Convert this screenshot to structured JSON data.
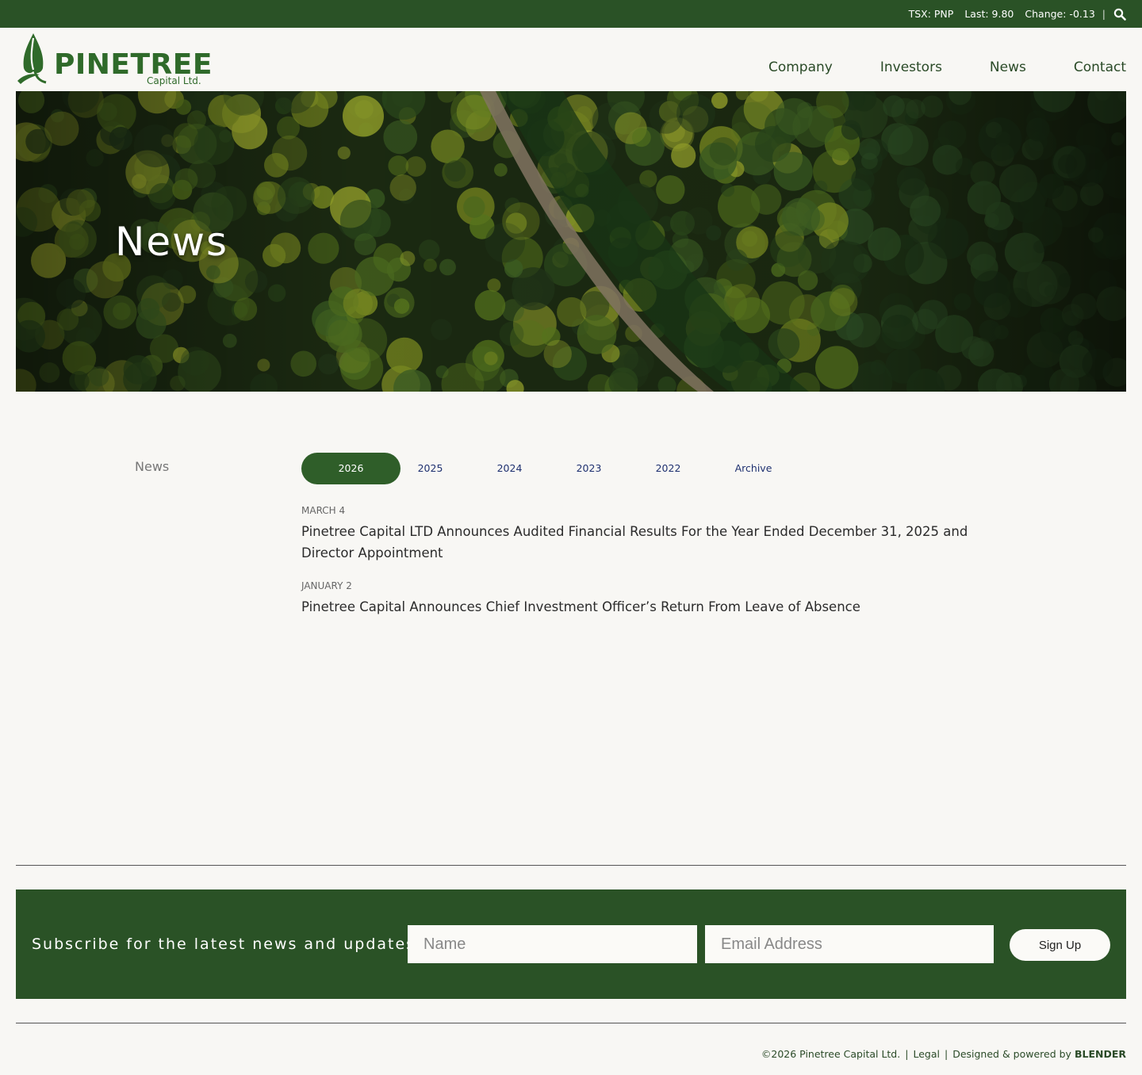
{
  "ticker": {
    "symbol": "TSX: PNP",
    "last": "Last: 9.80",
    "change": "Change: -0.13",
    "separator": "|",
    "search_icon": "search-icon"
  },
  "logo": {
    "word": "PINETREE",
    "sub": "Capital Ltd.",
    "icon": "pine-tree-logo-icon",
    "color": "#2f6a2a"
  },
  "nav": [
    {
      "label": "Company"
    },
    {
      "label": "Investors"
    },
    {
      "label": "News"
    },
    {
      "label": "Contact"
    }
  ],
  "hero": {
    "title": "News"
  },
  "sidebar": {
    "label": "News"
  },
  "year_tabs": [
    {
      "label": "2026",
      "active": true
    },
    {
      "label": "2025",
      "active": false
    },
    {
      "label": "2024",
      "active": false
    },
    {
      "label": "2023",
      "active": false
    },
    {
      "label": "2022",
      "active": false
    },
    {
      "label": "Archive",
      "active": false
    }
  ],
  "news": [
    {
      "date": "MARCH 4",
      "title": "Pinetree Capital LTD Announces Audited Financial Results For the Year Ended December 31, 2025 and Director Appointment"
    },
    {
      "date": "JANUARY 2",
      "title": "Pinetree Capital Announces Chief Investment Officer’s Return From Leave of Absence"
    }
  ],
  "subscribe": {
    "label": "Subscribe for the latest news and updates",
    "name_placeholder": "Name",
    "email_placeholder": "Email Address",
    "button": "Sign Up"
  },
  "footer": {
    "copyright": "©2026 Pinetree Capital Ltd.",
    "legal": "Legal",
    "designed": "Designed & powered by",
    "brand": "BLENDER",
    "pipe": "|"
  },
  "colors": {
    "brand_green": "#2a5226",
    "active_tab": "#2f5e29",
    "tab_text": "#1f3170",
    "background": "#f8f7f4"
  }
}
